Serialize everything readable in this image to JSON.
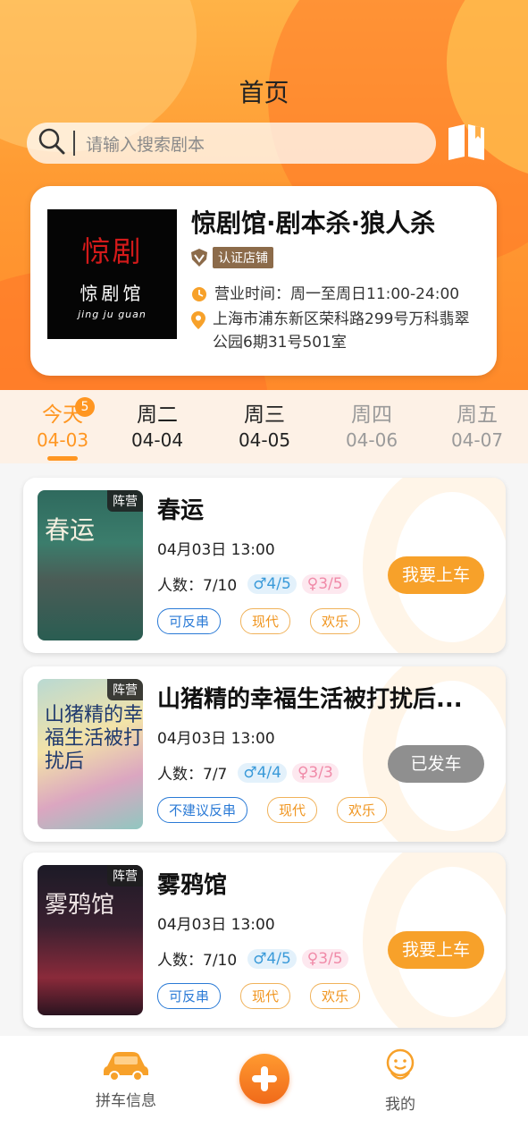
{
  "header": {
    "title": "首页"
  },
  "search": {
    "placeholder": "请输入搜索剧本"
  },
  "store": {
    "logo_text_big": "惊剧",
    "logo_text_mid": "惊剧馆",
    "logo_text_small": "jing ju guan",
    "name": "惊剧馆·剧本杀·狼人杀",
    "badge": "认证店铺",
    "hours": "营业时间：周一至周日11:00-24:00",
    "address": "上海市浦东新区荣科路299号万科翡翠公园6期31号501室"
  },
  "tabs": [
    {
      "day": "今天",
      "date": "04-03",
      "badge": "5",
      "state": "active"
    },
    {
      "day": "周二",
      "date": "04-04",
      "state": "normal"
    },
    {
      "day": "周三",
      "date": "04-05",
      "state": "normal"
    },
    {
      "day": "周四",
      "date": "04-06",
      "state": "faded"
    },
    {
      "day": "周五",
      "date": "04-07",
      "state": "faded"
    }
  ],
  "games": [
    {
      "poster_tag": "阵营",
      "poster_title": "春运",
      "title": "春运",
      "datetime": "04月03日  13:00",
      "people_label": "人数：7/10",
      "male": "♂4/5",
      "female": "♀3/5",
      "tags": [
        "可反串",
        "现代",
        "欢乐"
      ],
      "action": "我要上车"
    },
    {
      "poster_tag": "阵营",
      "poster_title": "山猪精的幸福生活被打扰后",
      "title": "山猪精的幸福生活被打扰后...",
      "datetime": "04月03日  13:00",
      "people_label": "人数：7/7",
      "male": "♂4/4",
      "female": "♀3/3",
      "tags": [
        "不建议反串",
        "现代",
        "欢乐"
      ],
      "action": "已发车"
    },
    {
      "poster_tag": "阵营",
      "poster_title": "雾鸦馆",
      "title": "雾鸦馆",
      "datetime": "04月03日  13:00",
      "people_label": "人数：7/10",
      "male": "♂4/5",
      "female": "♀3/5",
      "tags": [
        "可反串",
        "现代",
        "欢乐"
      ],
      "action": "我要上车"
    }
  ],
  "bottom_nav": {
    "carpool": "拼车信息",
    "mine": "我的"
  },
  "colors": {
    "accent": "#ff9621",
    "header_gradient_top": "#ffb347",
    "verified_badge": "#8c6b4a"
  }
}
